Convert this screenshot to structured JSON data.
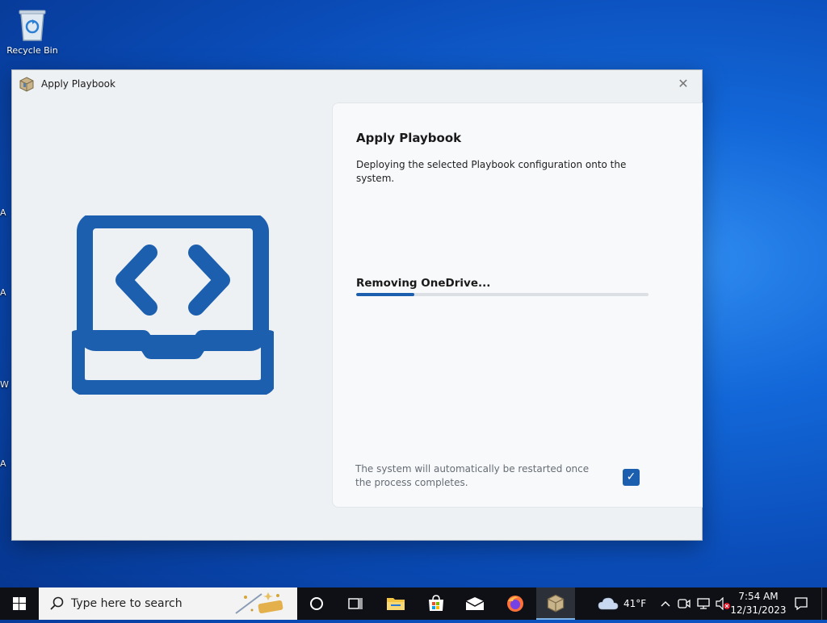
{
  "desktop": {
    "recycle_bin_label": "Recycle Bin",
    "peek_letters": [
      "A",
      "A",
      "W",
      "A"
    ]
  },
  "window": {
    "title": "Apply Playbook",
    "close_glyph": "✕",
    "icon": "playbook-package-icon",
    "illustration": "laptop-code-icon"
  },
  "panel": {
    "heading": "Apply Playbook",
    "description": "Deploying the selected Playbook configuration onto the system.",
    "status": "Removing OneDrive...",
    "progress": 0.2,
    "note": "The system will automatically be restarted once the process completes.",
    "restart_checked": true,
    "check_glyph": "✓"
  },
  "taskbar": {
    "search_placeholder": "Type here to search",
    "pinned": [
      "cortana-icon",
      "task-view-icon",
      "file-explorer-icon",
      "microsoft-store-icon",
      "mail-icon",
      "firefox-icon",
      "playbook-app-icon"
    ],
    "weather": "41°F",
    "clock_time": "7:54 AM",
    "clock_date": "12/31/2023"
  },
  "colors": {
    "accent": "#1b5fae",
    "desktop": "#1367d8",
    "taskbar": "#0e1016"
  }
}
